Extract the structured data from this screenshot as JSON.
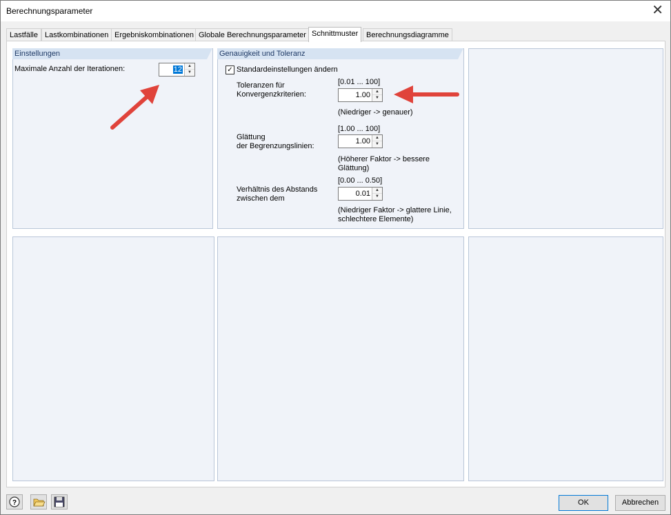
{
  "window": {
    "title": "Berechnungsparameter",
    "close_glyph": "✕"
  },
  "tabs": [
    {
      "label": "Lastfälle"
    },
    {
      "label": "Lastkombinationen"
    },
    {
      "label": "Ergebniskombinationen"
    },
    {
      "label": "Globale Berechnungsparameter"
    },
    {
      "label": "Schnittmuster",
      "active": true
    },
    {
      "label": "Berechnungsdiagramme"
    }
  ],
  "settings": {
    "header": "Einstellungen",
    "iterations_label": "Maximale Anzahl der Iterationen:",
    "iterations_value": "12"
  },
  "accuracy": {
    "header": "Genauigkeit und Toleranz",
    "change_defaults_label": "Standardeinstellungen ändern",
    "change_defaults_checked": true,
    "tolerance": {
      "label_line1": "Toleranzen für",
      "label_line2": "Konvergenzkriterien:",
      "range": "[0.01 ... 100]",
      "value": "1.00",
      "hint": "(Niedriger -> genauer)"
    },
    "smoothing": {
      "label_line1": "Glättung",
      "label_line2": "der Begrenzungslinien:",
      "range": "[1.00 ... 100]",
      "value": "1.00",
      "hint_line1": "(Höherer Faktor -> bessere",
      "hint_line2": "Glättung)"
    },
    "distance_ratio": {
      "label_line1": "Verhältnis des Abstands",
      "label_line2": "zwischen dem",
      "range": "[0.00 ... 0.50]",
      "value": "0.01",
      "hint_line1": "(Niedriger Faktor -> glattere Linie,",
      "hint_line2": "schlechtere Elemente)"
    }
  },
  "footer": {
    "ok_label": "OK",
    "cancel_label": "Abbrechen"
  },
  "colors": {
    "annotation_arrow": "#e0433b",
    "accent": "#0078d7"
  }
}
